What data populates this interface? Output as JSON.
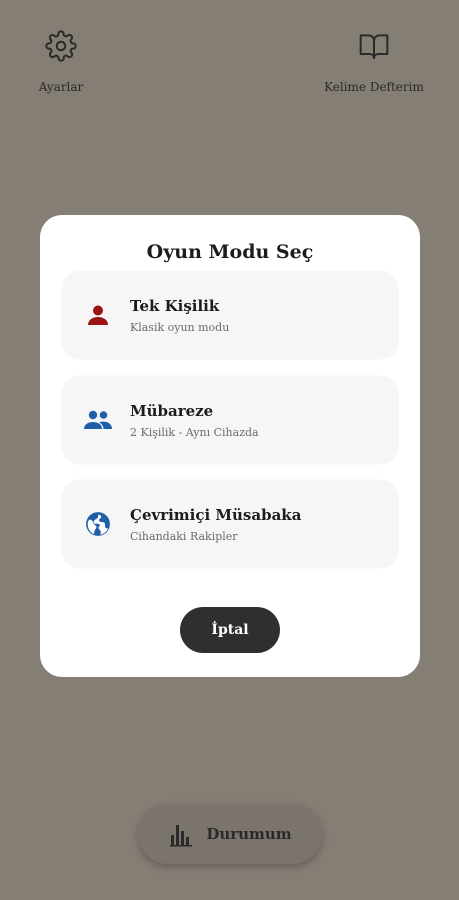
{
  "top_bar": {
    "settings_label": "Ayarlar",
    "notebook_label": "Kelime Defterim"
  },
  "modal": {
    "title": "Oyun Modu Seç",
    "options": [
      {
        "title": "Tek Kişilik",
        "subtitle": "Klasik oyun modu",
        "icon": "person-icon",
        "color": "#9b1414"
      },
      {
        "title": "Mübareze",
        "subtitle": "2 Kişilik - Aynı Cihazda",
        "icon": "group-icon",
        "color": "#1f5fa8"
      },
      {
        "title": "Çevrimiçi Müsabaka",
        "subtitle": "Cihandaki Rakipler",
        "icon": "globe-icon",
        "color": "#1f5fa8"
      }
    ],
    "cancel_label": "İptal"
  },
  "bottom": {
    "status_label": "Durumum"
  },
  "colors": {
    "background": "#857e75",
    "modal_bg": "#ffffff",
    "card_bg": "#f7f6f6",
    "cancel_bg": "#2f2f2f"
  }
}
